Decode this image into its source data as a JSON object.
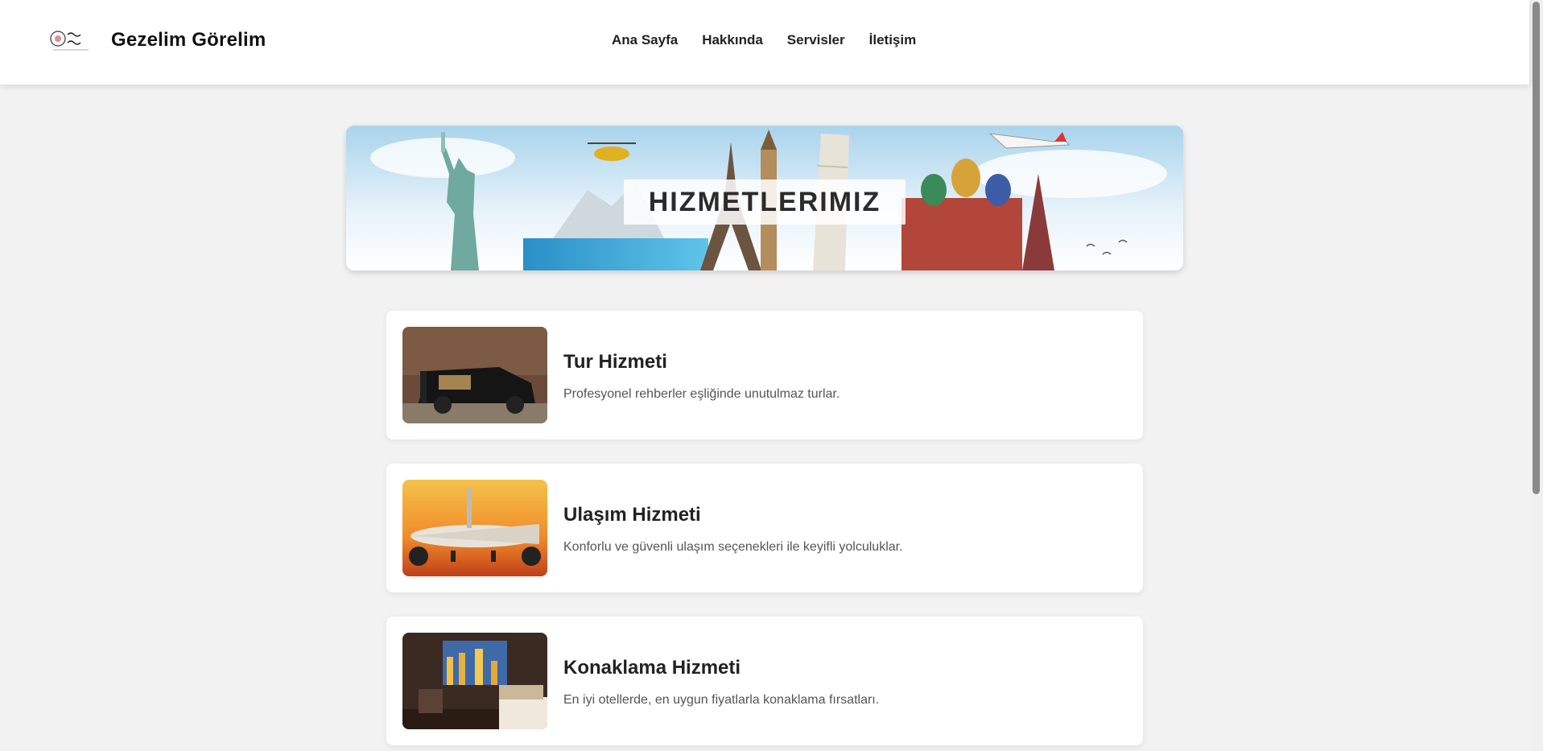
{
  "header": {
    "brand": "Gezelim Görelim",
    "nav": [
      "Ana Sayfa",
      "Hakkında",
      "Servisler",
      "İletişim"
    ]
  },
  "banner": {
    "title": "HIZMETLERIMIZ"
  },
  "services": [
    {
      "title": "Tur Hizmeti",
      "desc": "Profesyonel rehberler eşliğinde unutulmaz turlar."
    },
    {
      "title": "Ulaşım Hizmeti",
      "desc": "Konforlu ve güvenli ulaşım seçenekleri ile keyifli yolculuklar."
    },
    {
      "title": "Konaklama Hizmeti",
      "desc": "En iyi otellerde, en uygun fiyatlarla konaklama fırsatları."
    }
  ],
  "icons": {
    "logo": "logo-icon",
    "banner_image": "travel-landmarks-image",
    "tour_image": "black-van-image",
    "transport_image": "airplane-sunset-image",
    "accommodation_image": "hotel-room-image"
  }
}
